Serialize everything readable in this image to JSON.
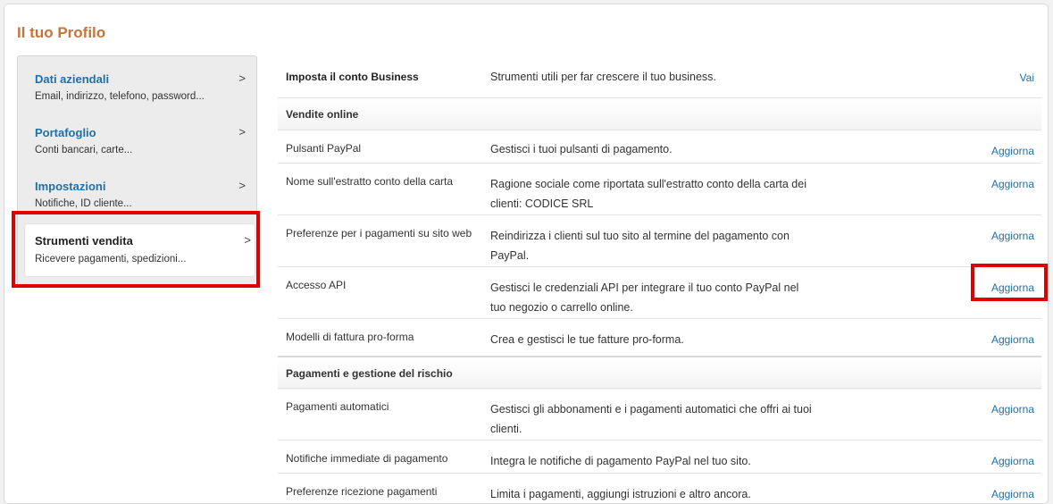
{
  "page": {
    "title": "Il tuo Profilo"
  },
  "sidebar": {
    "items": [
      {
        "title": "Dati aziendali",
        "desc": "Email, indirizzo, telefono, password...",
        "chev": ">"
      },
      {
        "title": "Portafoglio",
        "desc": "Conti bancari, carte...",
        "chev": ">"
      },
      {
        "title": "Impostazioni",
        "desc": "Notifiche, ID cliente...",
        "chev": ">"
      },
      {
        "title": "Strumenti vendita",
        "desc": "Ricevere pagamenti, spedizioni...",
        "chev": ">"
      }
    ]
  },
  "main": {
    "top_row": {
      "name": "Imposta il conto Business",
      "desc": "Strumenti utili per far crescere il tuo business.",
      "action": "Vai"
    },
    "sections": [
      {
        "title": "Vendite online"
      },
      {
        "title": "Pagamenti e gestione del rischio"
      }
    ],
    "rows": [
      {
        "name": "Pulsanti PayPal",
        "desc": "Gestisci i tuoi pulsanti di pagamento.",
        "action": "Aggiorna"
      },
      {
        "name": "Nome sull'estratto conto della carta",
        "desc": "Ragione sociale come riportata sull'estratto conto della carta dei clienti: CODICE SRL",
        "action": "Aggiorna"
      },
      {
        "name": "Preferenze per i pagamenti su sito web",
        "desc": "Reindirizza i clienti sul tuo sito al termine del pagamento con PayPal.",
        "action": "Aggiorna"
      },
      {
        "name": "Accesso API",
        "desc": "Gestisci le credenziali API per integrare il tuo conto PayPal nel tuo negozio o carrello online.",
        "action": "Aggiorna"
      },
      {
        "name": "Modelli di fattura pro-forma",
        "desc": "Crea e gestisci le tue fatture pro-forma.",
        "action": "Aggiorna"
      },
      {
        "name": "Pagamenti automatici",
        "desc": "Gestisci gli abbonamenti e i pagamenti automatici che offri ai tuoi clienti.",
        "action": "Aggiorna"
      },
      {
        "name": "Notifiche immediate di pagamento",
        "desc": "Integra le notifiche di pagamento PayPal nel tuo sito.",
        "action": "Aggiorna"
      },
      {
        "name": "Preferenze ricezione pagamenti",
        "desc": "Limita i pagamenti, aggiungi istruzioni e altro ancora.",
        "action": "Aggiorna"
      }
    ]
  },
  "colors": {
    "title": "#c8733a",
    "link": "#1f6fad",
    "highlight": "#e00000"
  }
}
